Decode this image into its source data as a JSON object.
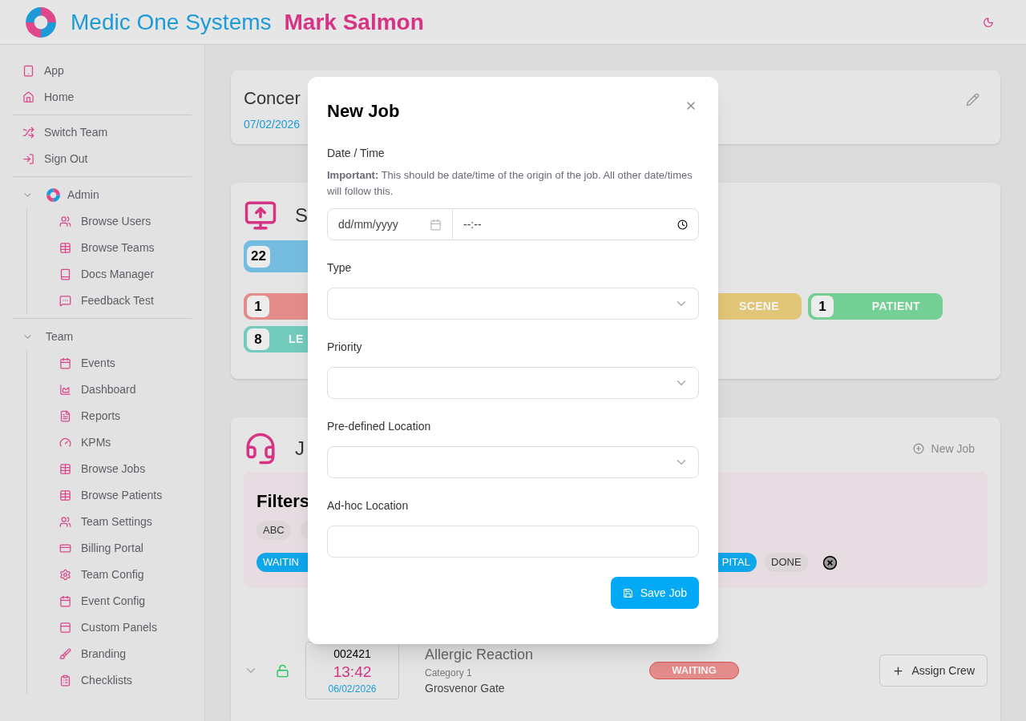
{
  "header": {
    "brand": "Medic One Systems",
    "user": "Mark Salmon"
  },
  "sidebar": {
    "groups": [
      {
        "items": [
          {
            "label": "App"
          },
          {
            "label": "Home"
          }
        ]
      },
      {
        "items": [
          {
            "label": "Switch Team"
          },
          {
            "label": "Sign Out"
          }
        ]
      },
      {
        "section": {
          "label": "Admin",
          "expanded": true,
          "children": [
            {
              "label": "Browse Users"
            },
            {
              "label": "Browse Teams"
            },
            {
              "label": "Docs Manager"
            },
            {
              "label": "Feedback Test"
            }
          ]
        }
      },
      {
        "section": {
          "label": "Team",
          "expanded": true,
          "children": [
            {
              "label": "Events"
            },
            {
              "label": "Dashboard"
            },
            {
              "label": "Reports"
            },
            {
              "label": "KPMs"
            },
            {
              "label": "Browse Jobs"
            },
            {
              "label": "Browse Patients"
            },
            {
              "label": "Team Settings"
            },
            {
              "label": "Billing Portal"
            },
            {
              "label": "Team Config"
            },
            {
              "label": "Event Config"
            },
            {
              "label": "Custom Panels"
            },
            {
              "label": "Branding"
            },
            {
              "label": "Checklists"
            }
          ]
        }
      }
    ]
  },
  "event_card": {
    "title": "Concer",
    "date": "07/02/2026"
  },
  "stats_card": {
    "title": "S",
    "counters": [
      {
        "count": "22",
        "color": "#74bde0"
      },
      {
        "count": "1",
        "color": "#e48b8b"
      },
      {
        "label": "SCENE",
        "color": "#e2c677"
      },
      {
        "count": "1",
        "label": "PATIENT",
        "color": "#74cf95"
      },
      {
        "count": "8",
        "label": "LE",
        "color": "#72cbbd"
      }
    ]
  },
  "jobs_card": {
    "title": "J",
    "new_job_button": "New Job",
    "filters": {
      "title": "Filters",
      "tags": [
        {
          "label": "ABC",
          "selected": false
        },
        {
          "selected": false
        }
      ],
      "statuses": [
        {
          "label": "WAITIN",
          "selected": true
        },
        {
          "label": "PITAL",
          "selected": true
        },
        {
          "label": "DONE",
          "selected": false
        }
      ]
    },
    "jobs": [
      {
        "number": "002421",
        "time": "13:42",
        "date": "06/02/2026",
        "title": "Allergic Reaction",
        "category": "Category 1",
        "location": "Grosvenor Gate",
        "status": "WAITING",
        "locked": false,
        "action": "Assign Crew"
      }
    ]
  },
  "dialog": {
    "title": "New Job",
    "fields": [
      {
        "kind": "datetime",
        "label": "Date / Time",
        "note": "**Important:** This should be date/time of the origin of the job. All other date/times will follow this.",
        "date_placeholder": "dd/mm/yyyy",
        "time_placeholder": "--:--"
      },
      {
        "kind": "select",
        "label": "Type"
      },
      {
        "kind": "select",
        "label": "Priority"
      },
      {
        "kind": "select",
        "label": "Pre-defined Location"
      },
      {
        "kind": "text",
        "label": "Ad-hoc Location"
      }
    ],
    "save_button": "Save Job"
  }
}
